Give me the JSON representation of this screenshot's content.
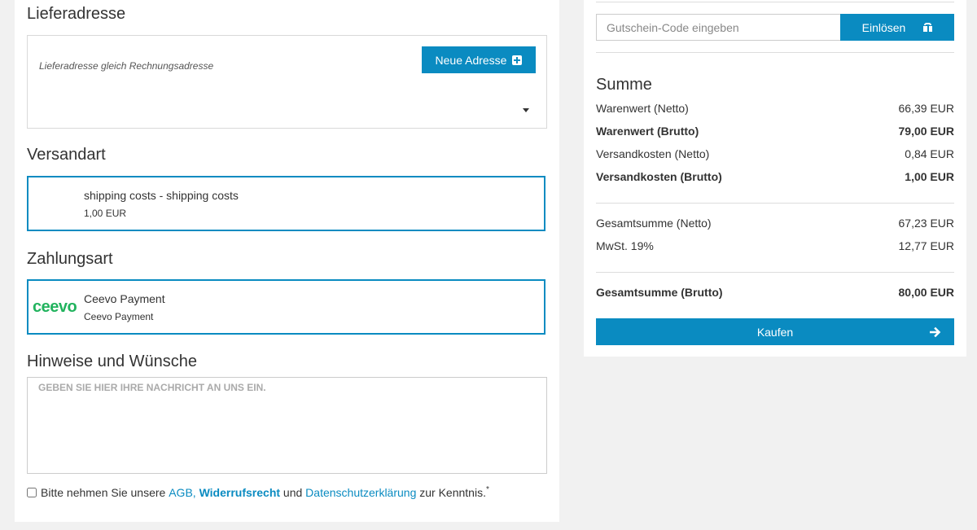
{
  "delivery": {
    "title": "Lieferadresse",
    "same_as_billing": "Lieferadresse gleich Rechnungsadresse",
    "new_address_label": "Neue Adresse"
  },
  "shipping": {
    "title": "Versandart",
    "option_name": "shipping costs - shipping costs",
    "option_price": "1,00 EUR"
  },
  "payment": {
    "title": "Zahlungsart",
    "logo_text": "ceevo",
    "option_name": "Ceevo Payment",
    "option_sub": "Ceevo Payment"
  },
  "notes": {
    "title": "Hinweise und Wünsche",
    "placeholder": "GEBEN SIE HIER IHRE NACHRICHT AN UNS EIN."
  },
  "terms": {
    "prefix": "Bitte nehmen Sie unsere",
    "agb": "AGB,",
    "withdrawal": "Widerrufsrecht",
    "and": "und",
    "privacy": "Datenschutzerklärung",
    "suffix": "zur Kenntnis.",
    "required_mark": "*"
  },
  "voucher": {
    "placeholder": "Gutschein-Code eingeben",
    "button_label": "Einlösen"
  },
  "summary": {
    "title": "Summe",
    "rows": [
      {
        "label": "Warenwert (Netto)",
        "value": "66,39 EUR"
      },
      {
        "label": "Warenwert (Brutto)",
        "value": "79,00 EUR"
      },
      {
        "label": "Versandkosten (Netto)",
        "value": "0,84 EUR"
      },
      {
        "label": "Versandkosten (Brutto)",
        "value": "1,00 EUR"
      },
      {
        "label": "Gesamtsumme (Netto)",
        "value": "67,23 EUR"
      },
      {
        "label": "MwSt. 19%",
        "value": "12,77 EUR"
      },
      {
        "label": "Gesamtsumme (Brutto)",
        "value": "80,00 EUR"
      }
    ],
    "buy_label": "Kaufen"
  },
  "colors": {
    "accent": "#0a8bc1",
    "ceevo_green": "#22b35e",
    "background": "#f1f1f1"
  }
}
